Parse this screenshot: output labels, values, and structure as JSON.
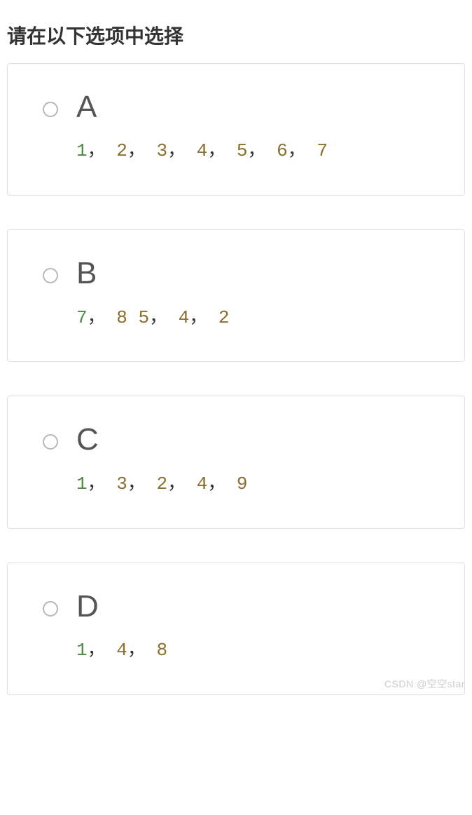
{
  "title": "请在以下选项中选择",
  "options": [
    {
      "letter": "A",
      "tokens": [
        {
          "text": "1",
          "cls": "num-green"
        },
        {
          "text": "，",
          "cls": "punct"
        },
        {
          "text": " 2",
          "cls": "num-brown"
        },
        {
          "text": "，",
          "cls": "punct"
        },
        {
          "text": " 3",
          "cls": "num-brown"
        },
        {
          "text": "，",
          "cls": "punct"
        },
        {
          "text": " 4",
          "cls": "num-brown"
        },
        {
          "text": "，",
          "cls": "punct"
        },
        {
          "text": " 5",
          "cls": "num-brown"
        },
        {
          "text": "，",
          "cls": "punct"
        },
        {
          "text": " 6",
          "cls": "num-brown"
        },
        {
          "text": "，",
          "cls": "punct"
        },
        {
          "text": " 7",
          "cls": "num-brown"
        }
      ]
    },
    {
      "letter": "B",
      "tokens": [
        {
          "text": "7",
          "cls": "num-green"
        },
        {
          "text": "，",
          "cls": "punct"
        },
        {
          "text": " 8",
          "cls": "num-brown"
        },
        {
          "text": " 5",
          "cls": "num-brown"
        },
        {
          "text": "，",
          "cls": "punct"
        },
        {
          "text": " 4",
          "cls": "num-brown"
        },
        {
          "text": "，",
          "cls": "punct"
        },
        {
          "text": " 2",
          "cls": "num-brown"
        }
      ]
    },
    {
      "letter": "C",
      "tokens": [
        {
          "text": "1",
          "cls": "num-green"
        },
        {
          "text": "，",
          "cls": "punct"
        },
        {
          "text": " 3",
          "cls": "num-brown"
        },
        {
          "text": "，",
          "cls": "punct"
        },
        {
          "text": " 2",
          "cls": "num-brown"
        },
        {
          "text": "，",
          "cls": "punct"
        },
        {
          "text": " 4",
          "cls": "num-brown"
        },
        {
          "text": "，",
          "cls": "punct"
        },
        {
          "text": " 9",
          "cls": "num-brown"
        }
      ]
    },
    {
      "letter": "D",
      "tokens": [
        {
          "text": "1",
          "cls": "num-green"
        },
        {
          "text": "，",
          "cls": "punct"
        },
        {
          "text": " 4",
          "cls": "num-brown"
        },
        {
          "text": "，",
          "cls": "punct"
        },
        {
          "text": " 8",
          "cls": "num-brown"
        }
      ]
    }
  ],
  "watermark": "CSDN @空空star"
}
